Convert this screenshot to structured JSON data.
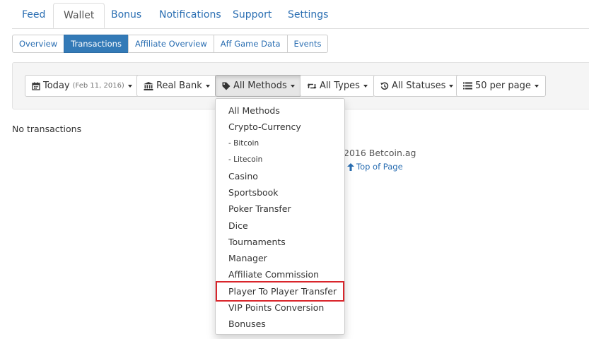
{
  "top_tabs": [
    "Feed",
    "Wallet",
    "Bonus",
    "Notifications",
    "Support",
    "Settings"
  ],
  "sub_tabs": [
    "Overview",
    "Transactions",
    "Affiliate Overview",
    "Aff Game Data",
    "Events"
  ],
  "filters": {
    "date_label": "Today",
    "date_value": "(Feb 11, 2016)",
    "bank": "Real Bank",
    "methods": "All Methods",
    "types": "All Types",
    "statuses": "All Statuses",
    "per_page": "50 per page"
  },
  "no_transactions": "No transactions",
  "footer": {
    "copyright": "2016 Betcoin.ag",
    "top_link": "Top of Page"
  },
  "methods_dropdown": {
    "items": [
      "All Methods",
      "Crypto-Currency",
      "- Bitcoin",
      "- Litecoin",
      "Casino",
      "Sportsbook",
      "Poker Transfer",
      "Dice",
      "Tournaments",
      "Manager",
      "Affiliate Commission",
      "Player To Player Transfer",
      "VIP Points Conversion",
      "Bonuses"
    ],
    "highlighted": "Player To Player Transfer"
  },
  "colors": {
    "link": "#2a6eb2",
    "active_tab": "#337ab7",
    "highlight_border": "#d9252b"
  },
  "icons": [
    "calendar-icon",
    "bank-icon",
    "tag-icon",
    "retweet-icon",
    "history-icon",
    "list-icon",
    "caret-down-icon",
    "arrow-up-icon"
  ]
}
